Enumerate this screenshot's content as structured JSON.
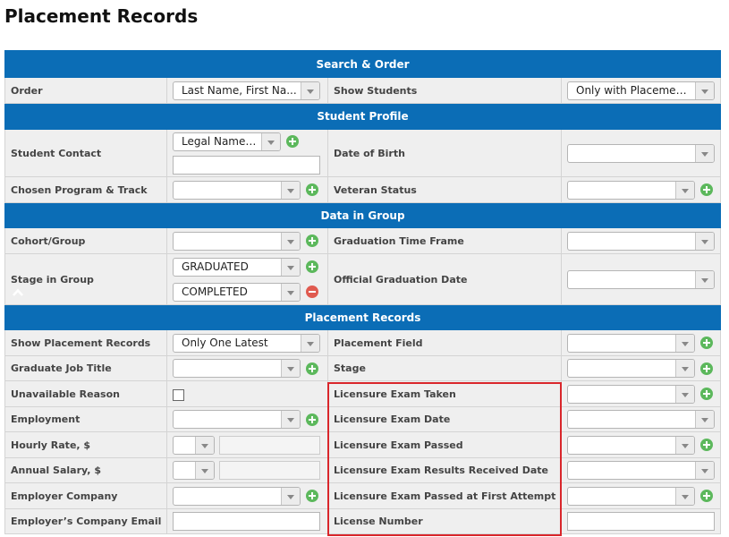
{
  "page_title": "Placement Records",
  "sections": {
    "search": "Search & Order",
    "profile": "Student Profile",
    "group": "Data in Group",
    "placement": "Placement Records"
  },
  "fields": {
    "order": {
      "label": "Order",
      "value": "Last Name, First Na..."
    },
    "show_students": {
      "label": "Show Students",
      "value": "Only with Placemen..."
    },
    "student_contact": {
      "label": "Student Contact",
      "value": "Legal Name & A...",
      "text": ""
    },
    "dob": {
      "label": "Date of Birth",
      "value": ""
    },
    "program": {
      "label": "Chosen Program & Track",
      "value": ""
    },
    "veteran": {
      "label": "Veteran Status",
      "value": ""
    },
    "cohort": {
      "label": "Cohort/Group",
      "value": ""
    },
    "grad_time": {
      "label": "Graduation Time Frame",
      "value": ""
    },
    "stage_group": {
      "label": "Stage in Group",
      "values": [
        "GRADUATED",
        "COMPLETED"
      ]
    },
    "official_grad": {
      "label": "Official Graduation Date",
      "value": ""
    },
    "show_placement": {
      "label": "Show Placement Records",
      "value": "Only One Latest"
    },
    "placement_field": {
      "label": "Placement Field",
      "value": ""
    },
    "job_title": {
      "label": "Graduate Job Title",
      "value": ""
    },
    "stage": {
      "label": "Stage",
      "value": ""
    },
    "unavailable": {
      "label": "Unavailable Reason",
      "checked": false
    },
    "exam_taken": {
      "label": "Licensure Exam Taken",
      "value": ""
    },
    "employment": {
      "label": "Employment",
      "value": ""
    },
    "exam_date": {
      "label": "Licensure Exam Date",
      "value": ""
    },
    "hourly": {
      "label": "Hourly Rate, $",
      "value": ""
    },
    "exam_passed": {
      "label": "Licensure Exam Passed",
      "value": ""
    },
    "annual": {
      "label": "Annual Salary, $",
      "value": ""
    },
    "results_date": {
      "label": "Licensure Exam Results Received Date",
      "value": ""
    },
    "employer": {
      "label": "Employer Company",
      "value": ""
    },
    "first_attempt": {
      "label": "Licensure Exam Passed at First Attempt",
      "value": ""
    },
    "employer_email": {
      "label": "Employer’s Company Email",
      "value": ""
    },
    "license_number": {
      "label": "License Number",
      "value": ""
    }
  },
  "colors": {
    "header": "#0b6db6",
    "add": "#5cb85c",
    "remove": "#e05a4f",
    "highlight": "#d9262b"
  }
}
